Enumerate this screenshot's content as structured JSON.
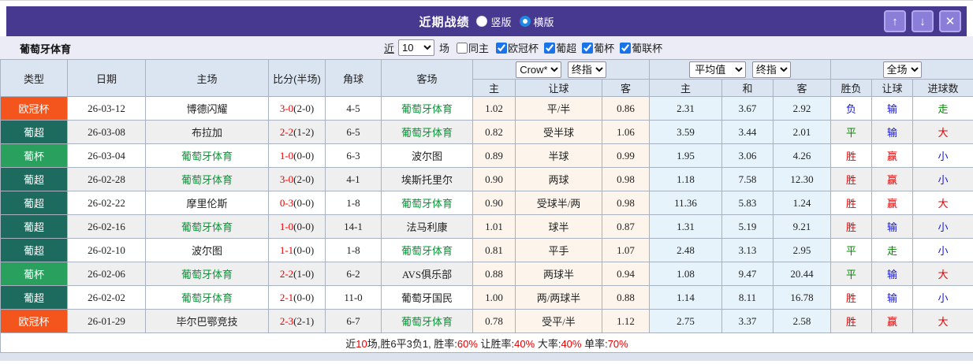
{
  "colors": {
    "type": {
      "ucl": "#f4551c",
      "liga": "#1d6a5e",
      "cup": "#2aa05f"
    },
    "titlebar_purple": "#46398f",
    "button_purple": "#8a7ed8",
    "radio_blue": "#1e88e5",
    "team_green": "#009933",
    "result_red": "#e60000",
    "result_blue": "#1414d8",
    "result_green": "#038a03",
    "odds_bg": "#fdf5ec",
    "avg_bg": "#e7f3fa",
    "header_bg": "#dbe5f1"
  },
  "titlebar": {
    "title": "近期战绩",
    "layout_options": [
      {
        "label": "竖版",
        "selected": false
      },
      {
        "label": "横版",
        "selected": true
      }
    ],
    "icons": {
      "up": "↑",
      "down": "↓",
      "close": "✕"
    }
  },
  "filterbar": {
    "team_name": "葡萄牙体育",
    "recent_link": "近",
    "count_value": "10",
    "matches_label": "场",
    "same_home": {
      "label": "同主",
      "checked": false
    },
    "leagues": [
      {
        "label": "欧冠杯",
        "checked": true
      },
      {
        "label": "葡超",
        "checked": true
      },
      {
        "label": "葡杯",
        "checked": true
      },
      {
        "label": "葡联杯",
        "checked": true
      }
    ]
  },
  "table": {
    "columns": {
      "type": "类型",
      "date": "日期",
      "home": "主场",
      "score": "比分(半场)",
      "corner": "角球",
      "away": "客场",
      "odds_home": "主",
      "odds_line": "让球",
      "odds_away": "客",
      "avg_home": "主",
      "avg_draw": "和",
      "avg_away": "客",
      "result_wdl": "胜负",
      "result_handicap": "让球",
      "result_goals": "进球数"
    },
    "selects": {
      "company": "Crow*",
      "company_stage": "终指",
      "average": "平均值",
      "average_stage": "终指",
      "scope": "全场"
    },
    "rows": [
      {
        "type": "欧冠杯",
        "type_key": "ucl",
        "date": "26-03-12",
        "home": "博德闪耀",
        "home_team": false,
        "score": "3-0",
        "half": "(2-0)",
        "corner": "4-5",
        "away": "葡萄牙体育",
        "away_team": true,
        "oh": "1.02",
        "line": "平/半",
        "oa": "0.86",
        "ah": "2.31",
        "ad": "3.67",
        "aa": "2.92",
        "wdl": {
          "t": "负",
          "c": "blue"
        },
        "hc": {
          "t": "输",
          "c": "blue"
        },
        "goal": {
          "t": "走",
          "c": "green"
        }
      },
      {
        "type": "葡超",
        "type_key": "liga",
        "date": "26-03-08",
        "home": "布拉加",
        "home_team": false,
        "score": "2-2",
        "half": "(1-2)",
        "corner": "6-5",
        "away": "葡萄牙体育",
        "away_team": true,
        "oh": "0.82",
        "line": "受半球",
        "oa": "1.06",
        "ah": "3.59",
        "ad": "3.44",
        "aa": "2.01",
        "wdl": {
          "t": "平",
          "c": "green"
        },
        "hc": {
          "t": "输",
          "c": "blue"
        },
        "goal": {
          "t": "大",
          "c": "red"
        }
      },
      {
        "type": "葡杯",
        "type_key": "cup",
        "date": "26-03-04",
        "home": "葡萄牙体育",
        "home_team": true,
        "score": "1-0",
        "half": "(0-0)",
        "corner": "6-3",
        "away": "波尔图",
        "away_team": false,
        "oh": "0.89",
        "line": "半球",
        "oa": "0.99",
        "ah": "1.95",
        "ad": "3.06",
        "aa": "4.26",
        "wdl": {
          "t": "胜",
          "c": "red"
        },
        "hc": {
          "t": "赢",
          "c": "red"
        },
        "goal": {
          "t": "小",
          "c": "blue"
        }
      },
      {
        "type": "葡超",
        "type_key": "liga",
        "date": "26-02-28",
        "home": "葡萄牙体育",
        "home_team": true,
        "score": "3-0",
        "half": "(2-0)",
        "corner": "4-1",
        "away": "埃斯托里尔",
        "away_team": false,
        "oh": "0.90",
        "line": "两球",
        "oa": "0.98",
        "ah": "1.18",
        "ad": "7.58",
        "aa": "12.30",
        "wdl": {
          "t": "胜",
          "c": "red"
        },
        "hc": {
          "t": "赢",
          "c": "red"
        },
        "goal": {
          "t": "小",
          "c": "blue"
        }
      },
      {
        "type": "葡超",
        "type_key": "liga",
        "date": "26-02-22",
        "home": "摩里伦斯",
        "home_team": false,
        "score": "0-3",
        "half": "(0-0)",
        "corner": "1-8",
        "away": "葡萄牙体育",
        "away_team": true,
        "oh": "0.90",
        "line": "受球半/两",
        "oa": "0.98",
        "ah": "11.36",
        "ad": "5.83",
        "aa": "1.24",
        "wdl": {
          "t": "胜",
          "c": "red"
        },
        "hc": {
          "t": "赢",
          "c": "red"
        },
        "goal": {
          "t": "大",
          "c": "red"
        }
      },
      {
        "type": "葡超",
        "type_key": "liga",
        "date": "26-02-16",
        "home": "葡萄牙体育",
        "home_team": true,
        "score": "1-0",
        "half": "(0-0)",
        "corner": "14-1",
        "away": "法马利康",
        "away_team": false,
        "oh": "1.01",
        "line": "球半",
        "oa": "0.87",
        "ah": "1.31",
        "ad": "5.19",
        "aa": "9.21",
        "wdl": {
          "t": "胜",
          "c": "red"
        },
        "hc": {
          "t": "输",
          "c": "blue"
        },
        "goal": {
          "t": "小",
          "c": "blue"
        }
      },
      {
        "type": "葡超",
        "type_key": "liga",
        "date": "26-02-10",
        "home": "波尔图",
        "home_team": false,
        "score": "1-1",
        "half": "(0-0)",
        "corner": "1-8",
        "away": "葡萄牙体育",
        "away_team": true,
        "oh": "0.81",
        "line": "平手",
        "oa": "1.07",
        "ah": "2.48",
        "ad": "3.13",
        "aa": "2.95",
        "wdl": {
          "t": "平",
          "c": "green"
        },
        "hc": {
          "t": "走",
          "c": "green"
        },
        "goal": {
          "t": "小",
          "c": "blue"
        }
      },
      {
        "type": "葡杯",
        "type_key": "cup",
        "date": "26-02-06",
        "home": "葡萄牙体育",
        "home_team": true,
        "score": "2-2",
        "half": "(1-0)",
        "corner": "6-2",
        "away": "AVS俱乐部",
        "away_team": false,
        "oh": "0.88",
        "line": "两球半",
        "oa": "0.94",
        "ah": "1.08",
        "ad": "9.47",
        "aa": "20.44",
        "wdl": {
          "t": "平",
          "c": "green"
        },
        "hc": {
          "t": "输",
          "c": "blue"
        },
        "goal": {
          "t": "大",
          "c": "red"
        }
      },
      {
        "type": "葡超",
        "type_key": "liga",
        "date": "26-02-02",
        "home": "葡萄牙体育",
        "home_team": true,
        "score": "2-1",
        "half": "(0-0)",
        "corner": "11-0",
        "away": "葡萄牙国民",
        "away_team": false,
        "oh": "1.00",
        "line": "两/两球半",
        "oa": "0.88",
        "ah": "1.14",
        "ad": "8.11",
        "aa": "16.78",
        "wdl": {
          "t": "胜",
          "c": "red"
        },
        "hc": {
          "t": "输",
          "c": "blue"
        },
        "goal": {
          "t": "小",
          "c": "blue"
        }
      },
      {
        "type": "欧冠杯",
        "type_key": "ucl",
        "date": "26-01-29",
        "home": "毕尔巴鄂竞技",
        "home_team": false,
        "score": "2-3",
        "half": "(2-1)",
        "corner": "6-7",
        "away": "葡萄牙体育",
        "away_team": true,
        "oh": "0.78",
        "line": "受平/半",
        "oa": "1.12",
        "ah": "2.75",
        "ad": "3.37",
        "aa": "2.58",
        "wdl": {
          "t": "胜",
          "c": "red"
        },
        "hc": {
          "t": "赢",
          "c": "red"
        },
        "goal": {
          "t": "大",
          "c": "red"
        }
      }
    ]
  },
  "summary": {
    "segments": [
      {
        "t": "近"
      },
      {
        "t": "10",
        "c": "red"
      },
      {
        "t": "场,胜6平3负1, 胜率:"
      },
      {
        "t": "60%",
        "c": "red"
      },
      {
        "t": " 让胜率:"
      },
      {
        "t": "40%",
        "c": "red"
      },
      {
        "t": " 大率:"
      },
      {
        "t": "40%",
        "c": "red"
      },
      {
        "t": " 单率:"
      },
      {
        "t": "70%",
        "c": "red"
      }
    ]
  }
}
